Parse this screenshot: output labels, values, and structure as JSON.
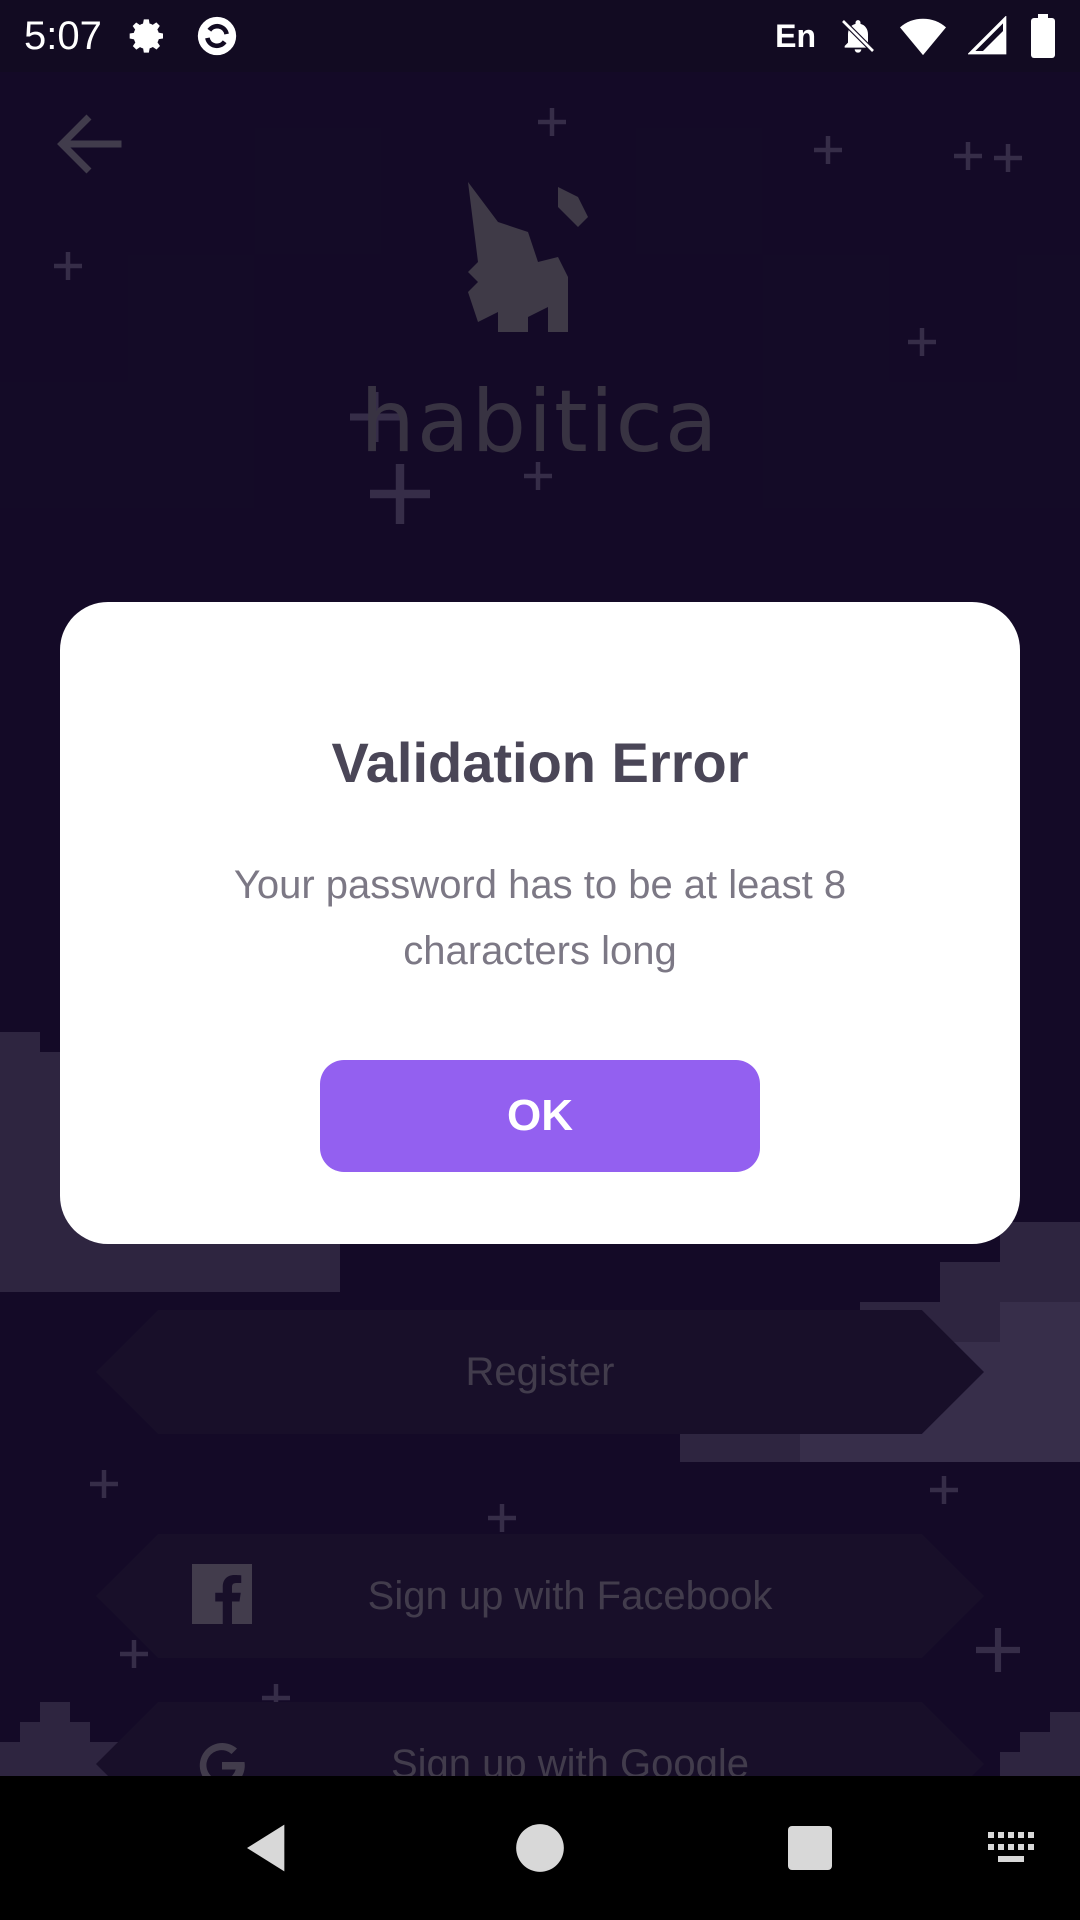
{
  "status_bar": {
    "time": "5:07",
    "language": "En",
    "icons": [
      "gear-icon",
      "sync-icon",
      "bell-off-icon",
      "wifi-icon",
      "signal-icon",
      "battery-icon"
    ]
  },
  "logo": {
    "wordmark": "habitica"
  },
  "background_buttons": {
    "register": "Register",
    "facebook": "Sign up with Facebook",
    "google": "Sign up with Google"
  },
  "dialog": {
    "title": "Validation Error",
    "message": "Your password has to be at least 8 characters long",
    "ok_label": "OK"
  },
  "colors": {
    "background": "#1d1035",
    "accent": "#9360f0",
    "dialog_bg": "#ffffff"
  },
  "nav_bar": {
    "icons": [
      "back-icon",
      "home-icon",
      "recents-icon",
      "keyboard-icon"
    ]
  }
}
